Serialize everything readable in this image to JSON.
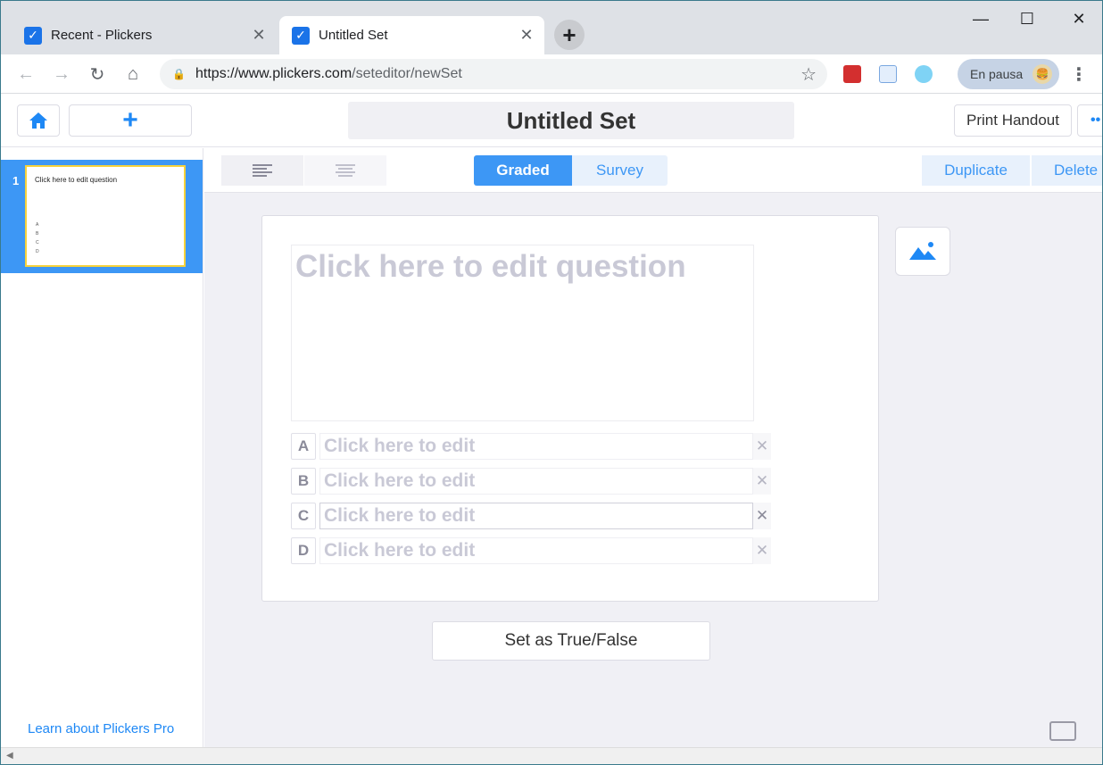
{
  "browser": {
    "tabs": [
      {
        "title": "Recent - Plickers",
        "active": false
      },
      {
        "title": "Untitled Set",
        "active": true
      }
    ],
    "url_prefix": "https://www.plickers.com",
    "url_path": "/seteditor/newSet",
    "profile_label": "En pausa",
    "accent": "#1a73e8"
  },
  "header": {
    "set_title": "Untitled Set",
    "print_label": "Print Handout"
  },
  "sidebar": {
    "slides": [
      {
        "number": "1",
        "question": "Click here to edit question",
        "choices": [
          "A",
          "B",
          "C",
          "D"
        ]
      }
    ],
    "learn_link": "Learn about Plickers Pro"
  },
  "subbar": {
    "graded_label": "Graded",
    "survey_label": "Survey",
    "duplicate_label": "Duplicate",
    "delete_label": "Delete"
  },
  "editor": {
    "question_placeholder": "Click here to edit question",
    "answers": [
      {
        "letter": "A",
        "placeholder": "Click here to edit"
      },
      {
        "letter": "B",
        "placeholder": "Click here to edit"
      },
      {
        "letter": "C",
        "placeholder": "Click here to edit"
      },
      {
        "letter": "D",
        "placeholder": "Click here to edit"
      }
    ],
    "true_false_label": "Set as True/False"
  },
  "colors": {
    "brand_blue": "#3d97f5",
    "selected_border": "#f7d23c"
  }
}
